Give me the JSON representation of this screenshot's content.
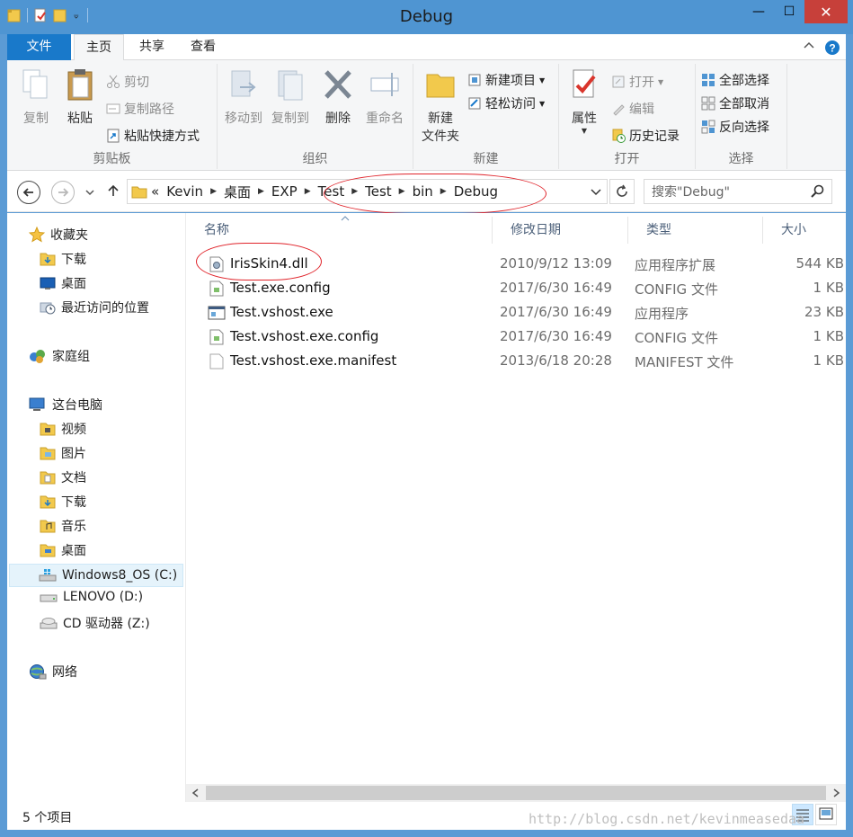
{
  "window": {
    "title": "Debug",
    "minimize": "—",
    "maximize": "☐",
    "close": "✕"
  },
  "ribbon_tabs": {
    "file": "文件",
    "home": "主页",
    "share": "共享",
    "view": "查看"
  },
  "ribbon": {
    "clipboard": {
      "label": "剪贴板",
      "copy": "复制",
      "paste": "粘贴",
      "cut": "剪切",
      "copy_path": "复制路径",
      "paste_shortcut": "粘贴快捷方式"
    },
    "organize": {
      "label": "组织",
      "move_to": "移动到",
      "copy_to": "复制到",
      "delete": "删除",
      "rename": "重命名"
    },
    "new": {
      "label": "新建",
      "new_folder_line1": "新建",
      "new_folder_line2": "文件夹",
      "new_item": "新建项目",
      "easy_access": "轻松访问"
    },
    "open": {
      "label": "打开",
      "properties": "属性",
      "open": "打开",
      "edit": "编辑",
      "history": "历史记录"
    },
    "select": {
      "label": "选择",
      "select_all": "全部选择",
      "select_none": "全部取消",
      "invert": "反向选择"
    }
  },
  "address": {
    "prefix": "«",
    "crumbs": [
      "Kevin",
      "桌面",
      "EXP",
      "Test",
      "Test",
      "bin",
      "Debug"
    ],
    "search_placeholder": "搜索\"Debug\""
  },
  "sidebar": {
    "favorites": "收藏夹",
    "fav_items": [
      "下载",
      "桌面",
      "最近访问的位置"
    ],
    "homegroup": "家庭组",
    "thispc": "这台电脑",
    "pc_items": [
      "视频",
      "图片",
      "文档",
      "下载",
      "音乐",
      "桌面"
    ],
    "drives": [
      "Windows8_OS (C:)",
      "LENOVO (D:)",
      "CD 驱动器 (Z:)"
    ],
    "network": "网络"
  },
  "columns": {
    "name": "名称",
    "date": "修改日期",
    "type": "类型",
    "size": "大小"
  },
  "files": [
    {
      "name": "IrisSkin4.dll",
      "date": "2010/9/12 13:09",
      "type": "应用程序扩展",
      "size": "544 KB",
      "icon": "dll-icon"
    },
    {
      "name": "Test.exe.config",
      "date": "2017/6/30 16:49",
      "type": "CONFIG 文件",
      "size": "1 KB",
      "icon": "config-icon"
    },
    {
      "name": "Test.vshost.exe",
      "date": "2017/6/30 16:49",
      "type": "应用程序",
      "size": "23 KB",
      "icon": "exe-icon"
    },
    {
      "name": "Test.vshost.exe.config",
      "date": "2017/6/30 16:49",
      "type": "CONFIG 文件",
      "size": "1 KB",
      "icon": "config-icon"
    },
    {
      "name": "Test.vshost.exe.manifest",
      "date": "2013/6/18 20:28",
      "type": "MANIFEST 文件",
      "size": "1 KB",
      "icon": "file-icon"
    }
  ],
  "status": {
    "count": "5 个项目",
    "watermark": "http://blog.csdn.net/kevinmeasedaa"
  },
  "colors": {
    "titlebar": "#4f95d2",
    "file_tab": "#1979ca",
    "annotation": "#e0242b"
  }
}
